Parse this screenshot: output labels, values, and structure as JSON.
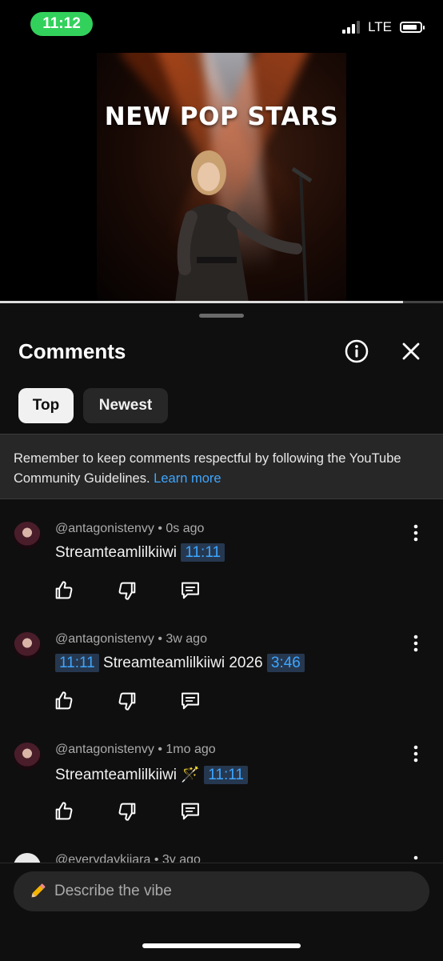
{
  "status_bar": {
    "time": "11:12",
    "network": "LTE"
  },
  "video": {
    "poster_title": "NEW POP STARS",
    "progress_fraction": 0.91
  },
  "comments_panel": {
    "title": "Comments",
    "filters": {
      "top": "Top",
      "newest": "Newest"
    },
    "notice": {
      "text": "Remember to keep comments respectful by following the YouTube Community Guidelines.",
      "link": "Learn more"
    },
    "comments": [
      {
        "author": "@antagonistenvy",
        "age": "0s ago",
        "text": "Streamteamlilkiiwi",
        "timestamp": "11:11"
      },
      {
        "author": "@antagonistenvy",
        "age": "3w ago",
        "timestamp_prefix": "11:11",
        "text": "Streamteamlilkiiwi 2026",
        "timestamp": "3:46"
      },
      {
        "author": "@antagonistenvy",
        "age": "1mo ago",
        "text": "Streamteamlilkiiwi 🪄",
        "timestamp": "11:11"
      },
      {
        "author": "@everydaykiiara",
        "age": "3y ago"
      }
    ],
    "composer": {
      "placeholder": "Describe the vibe"
    }
  },
  "colors": {
    "background": "#0f0f0f",
    "link": "#3ea6ff",
    "timestamp_bg": "#263850",
    "status_green": "#32d15c"
  },
  "icons": [
    "info-icon",
    "close-icon",
    "more-vert-icon",
    "like-icon",
    "dislike-icon",
    "reply-icon",
    "pencil-icon"
  ]
}
